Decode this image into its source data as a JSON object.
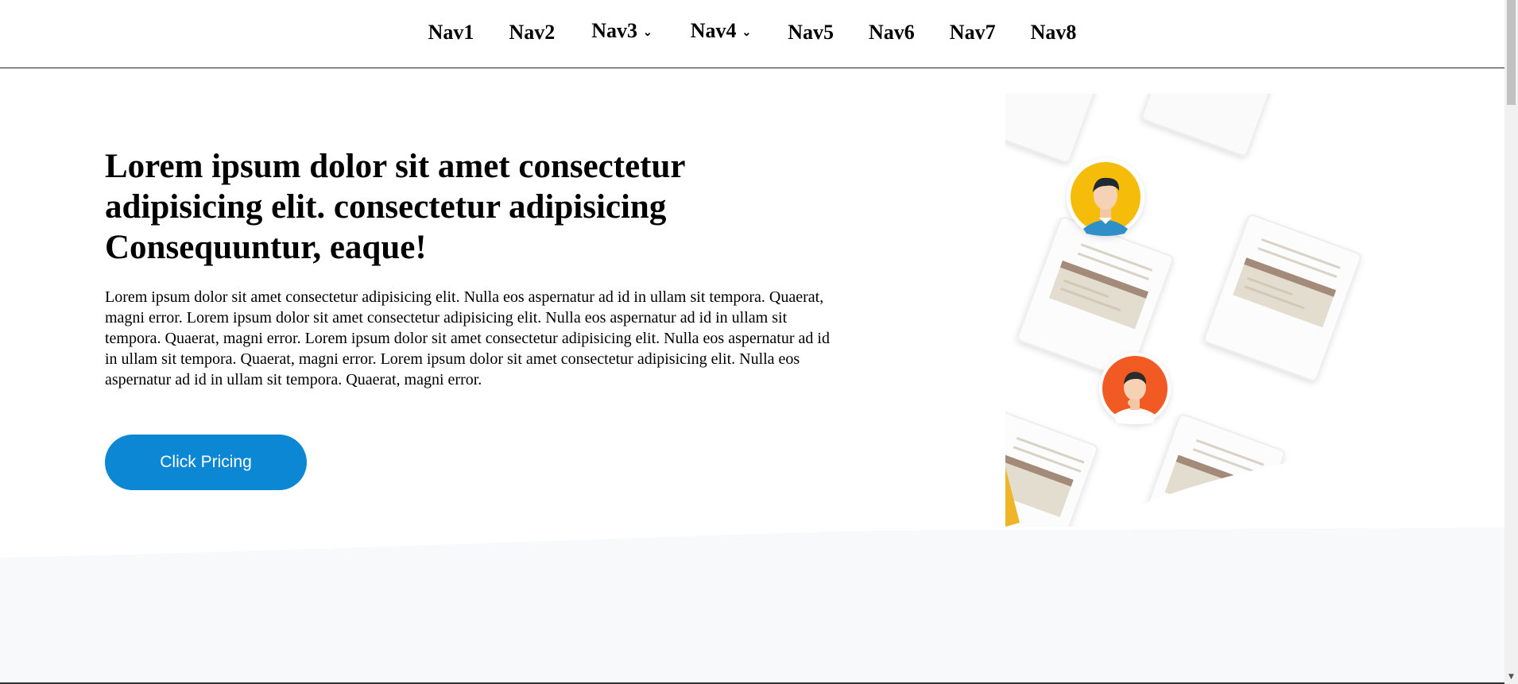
{
  "nav": {
    "items": [
      {
        "label": "Nav1",
        "dropdown": false
      },
      {
        "label": "Nav2",
        "dropdown": false
      },
      {
        "label": "Nav3",
        "dropdown": true
      },
      {
        "label": "Nav4",
        "dropdown": true
      },
      {
        "label": "Nav5",
        "dropdown": false
      },
      {
        "label": "Nav6",
        "dropdown": false
      },
      {
        "label": "Nav7",
        "dropdown": false
      },
      {
        "label": "Nav8",
        "dropdown": false
      }
    ],
    "dropdown_icon": "chevron-down-icon"
  },
  "hero": {
    "title": "Lorem ipsum dolor sit amet consectetur adipisicing elit. consectetur adipisicing Consequuntur, eaque!",
    "text": "Lorem ipsum dolor sit amet consectetur adipisicing elit. Nulla eos aspernatur ad id in ullam sit tempora. Quaerat, magni error. Lorem ipsum dolor sit amet consectetur adipisicing elit. Nulla eos aspernatur ad id in ullam sit tempora. Quaerat, magni error. Lorem ipsum dolor sit amet consectetur adipisicing elit. Nulla eos aspernatur ad id in ullam sit tempora. Quaerat, magni error. Lorem ipsum dolor sit amet consectetur adipisicing elit. Nulla eos aspernatur ad id in ullam sit tempora. Quaerat, magni error.",
    "cta_label": "Click Pricing"
  },
  "colors": {
    "cta": "#0b87d3",
    "avatar_yellow": "#f5bd0a",
    "avatar_orange": "#f15a22",
    "section_bg": "#f8f9fb"
  }
}
